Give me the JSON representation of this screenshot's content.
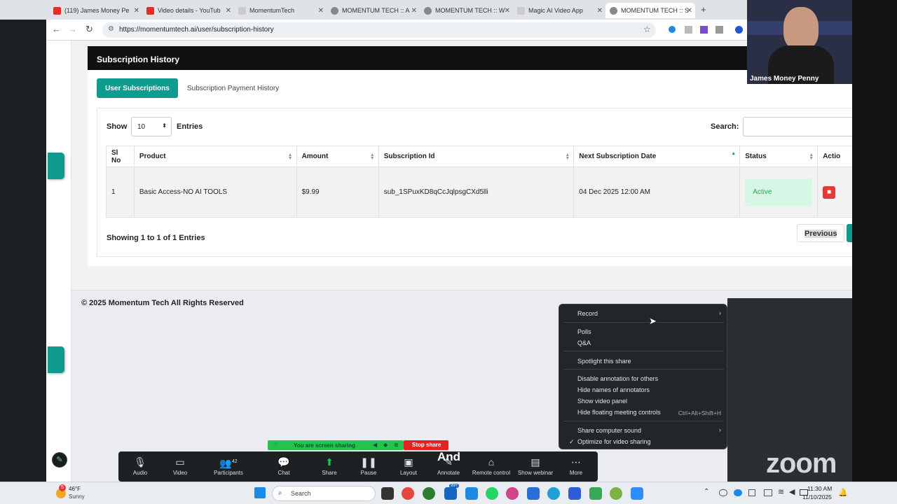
{
  "browser": {
    "tabs": [
      {
        "label": "(119) James Money Pe",
        "icon": "youtube-icon",
        "color": "#e52d27"
      },
      {
        "label": "Video details - YouTub",
        "icon": "youtube-icon",
        "color": "#e52d27"
      },
      {
        "label": "MomentumTech",
        "icon": "page-icon",
        "color": "#bbbbbb"
      },
      {
        "label": "MOMENTUM TECH :: A",
        "icon": "globe-icon",
        "color": "#666666"
      },
      {
        "label": "MOMENTUM TECH :: W",
        "icon": "globe-icon",
        "color": "#666666"
      },
      {
        "label": "Magic AI Video App",
        "icon": "page-icon",
        "color": "#bbbbbb"
      },
      {
        "label": "MOMENTUM TECH :: S",
        "icon": "globe-icon",
        "color": "#666666"
      }
    ],
    "url": "https://momentumtech.ai/user/subscription-history"
  },
  "page": {
    "title": "Subscription History",
    "tabs": {
      "user_subscriptions": "User Subscriptions",
      "payment_history": "Subscription Payment History"
    },
    "show_label": "Show",
    "entries_value": "10",
    "entries_label": "Entries",
    "search_label": "Search:",
    "table": {
      "headers": [
        "Sl No",
        "Product",
        "Amount",
        "Subscription Id",
        "Next Subscription Date",
        "Status",
        "Actio"
      ],
      "rows": [
        {
          "sl": "1",
          "product": "Basic Access-NO AI TOOLS",
          "amount": "$9.99",
          "sub_id": "sub_1SPuxKD8qCcJqlpsgCXd5lli",
          "next_date": "04 Dec 2025 12:00 AM",
          "status": "Active"
        }
      ]
    },
    "showing": "Showing 1 to 1 of 1 Entries",
    "previous": "Previous",
    "footer": "© 2025 Momentum Tech All Rights Reserved"
  },
  "webcam": {
    "name": "James Money Penny"
  },
  "context_menu": {
    "items": [
      "Record",
      "Polls",
      "Q&A",
      "Spotlight this share",
      "Disable annotation for others",
      "Hide names of annotators",
      "Show video panel",
      "Hide floating meeting controls",
      "Share computer sound",
      "Optimize for video sharing"
    ],
    "shortcut": "Ctrl+Alt+Shift+H"
  },
  "zoom": {
    "sharing_text": "You are screen sharing",
    "stop_share": "Stop share",
    "annotation_text": "And",
    "participants_count": "42",
    "toolbar": [
      "Audio",
      "Video",
      "Participants",
      "Chat",
      "Share",
      "Pause",
      "Layout",
      "Annotate",
      "Remote control",
      "Show webinar",
      "More"
    ],
    "logo": "zoom"
  },
  "taskbar": {
    "weather_temp": "46°F",
    "weather_desc": "Sunny",
    "weather_badge": "5",
    "search": "Search",
    "time": "11:30 AM",
    "date": "11/10/2025",
    "badge": "99+"
  }
}
